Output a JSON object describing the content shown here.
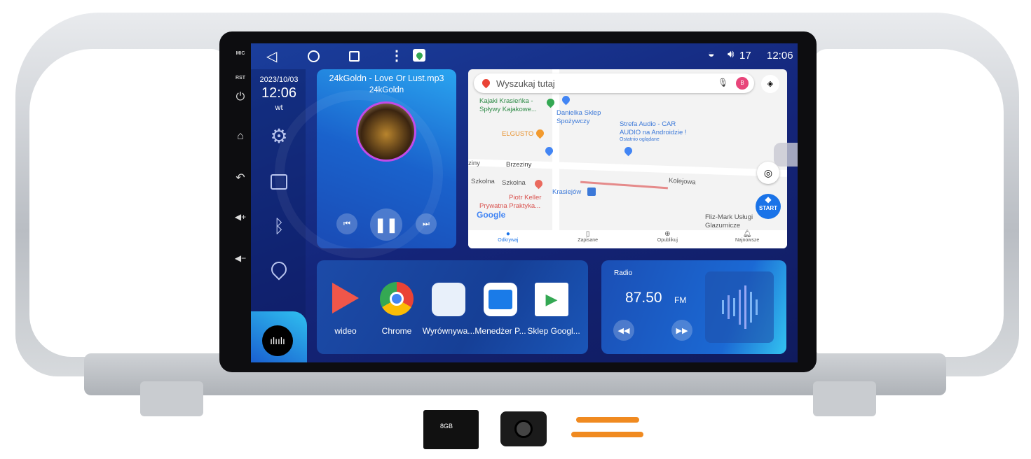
{
  "hardware_buttons": {
    "mic": "MIC",
    "rst": "RST",
    "icons": [
      "power-icon",
      "home-icon",
      "back-icon",
      "volume-up-icon",
      "volume-down-icon"
    ]
  },
  "status_bar": {
    "nav": [
      "back-icon",
      "home-icon",
      "recents-icon",
      "menu-icon",
      "google-maps-icon"
    ],
    "volume": "17",
    "time": "12:06"
  },
  "clock": {
    "date": "2023/10/03",
    "time": "12:06",
    "weekday": "wt"
  },
  "sidebar": {
    "items": [
      "settings-icon",
      "radio-icon",
      "bluetooth-icon",
      "location-icon",
      "voice-assistant-icon"
    ]
  },
  "music": {
    "title": "24kGoldn - Love Or Lust.mp3",
    "artist": "24kGoldn",
    "state": "playing"
  },
  "map": {
    "search_placeholder": "Wyszukaj tutaj",
    "avatar_letter": "B",
    "labels": {
      "kajaki": "Kajaki Krasieńka -",
      "kajaki2": "Spływy Kajakowe...",
      "danielka": "Danielka Sklep",
      "danielka2": "Spożywczy",
      "strefa": "Strefa Audio - CAR",
      "strefa2": "AUDIO na Androidzie !",
      "strefa3": "Ostatnio oglądane",
      "elgusto": "ELGUSTO",
      "brzeziny": "Brzeziny",
      "ziny": "ziny",
      "szkolna1": "Szkolna",
      "szkolna2": "Szkolna",
      "keller": "Piotr Keller",
      "keller2": "Prywatna Praktyka...",
      "krasiejow": "Krasiejów",
      "kolejowa": "Kolejowa",
      "flizmark": "Fliz-Mark Usługi",
      "flizmark2": "Glazurnicze",
      "google": "Google",
      "start": "START"
    },
    "nav": [
      "Odkrywaj",
      "Zapisane",
      "Opublikuj",
      "Najnowsze"
    ],
    "accent": "#1a73e8"
  },
  "apps": [
    {
      "label": "wideo"
    },
    {
      "label": "Chrome"
    },
    {
      "label": "Wyrównywa..."
    },
    {
      "label": "Menedżer P..."
    },
    {
      "label": "Sklep Googl..."
    }
  ],
  "radio": {
    "title": "Radio",
    "frequency": "87.50",
    "band": "FM"
  },
  "accessories": {
    "sd_card": "8GB"
  }
}
